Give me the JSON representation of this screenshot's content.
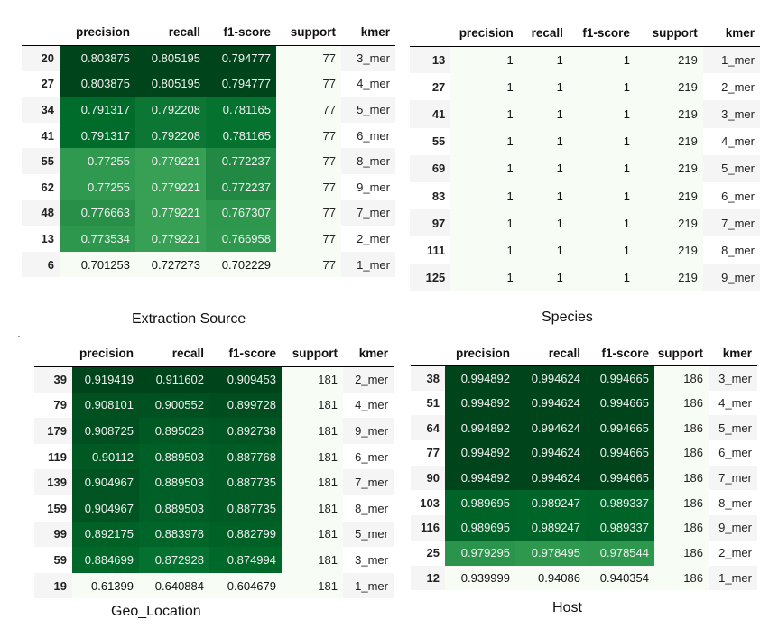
{
  "columns": [
    "",
    "precision",
    "recall",
    "f1-score",
    "support",
    "kmer"
  ],
  "tables": [
    {
      "caption": "Extraction Source",
      "rows": [
        {
          "idx": "20",
          "precision": "0.803875",
          "recall": "0.805195",
          "f1": "0.794777",
          "support": "77",
          "kmer": "3_mer",
          "p": 0.803875,
          "r": 0.805195,
          "f": 0.794777
        },
        {
          "idx": "27",
          "precision": "0.803875",
          "recall": "0.805195",
          "f1": "0.794777",
          "support": "77",
          "kmer": "4_mer",
          "p": 0.803875,
          "r": 0.805195,
          "f": 0.794777
        },
        {
          "idx": "34",
          "precision": "0.791317",
          "recall": "0.792208",
          "f1": "0.781165",
          "support": "77",
          "kmer": "5_mer",
          "p": 0.791317,
          "r": 0.792208,
          "f": 0.781165
        },
        {
          "idx": "41",
          "precision": "0.791317",
          "recall": "0.792208",
          "f1": "0.781165",
          "support": "77",
          "kmer": "6_mer",
          "p": 0.791317,
          "r": 0.792208,
          "f": 0.781165
        },
        {
          "idx": "55",
          "precision": "0.77255",
          "recall": "0.779221",
          "f1": "0.772237",
          "support": "77",
          "kmer": "8_mer",
          "p": 0.77255,
          "r": 0.779221,
          "f": 0.772237
        },
        {
          "idx": "62",
          "precision": "0.77255",
          "recall": "0.779221",
          "f1": "0.772237",
          "support": "77",
          "kmer": "9_mer",
          "p": 0.77255,
          "r": 0.779221,
          "f": 0.772237
        },
        {
          "idx": "48",
          "precision": "0.776663",
          "recall": "0.779221",
          "f1": "0.767307",
          "support": "77",
          "kmer": "7_mer",
          "p": 0.776663,
          "r": 0.779221,
          "f": 0.767307
        },
        {
          "idx": "13",
          "precision": "0.773534",
          "recall": "0.779221",
          "f1": "0.766958",
          "support": "77",
          "kmer": "2_mer",
          "p": 0.773534,
          "r": 0.779221,
          "f": 0.766958
        },
        {
          "idx": "6",
          "precision": "0.701253",
          "recall": "0.727273",
          "f1": "0.702229",
          "support": "77",
          "kmer": "1_mer",
          "p": 0.701253,
          "r": 0.727273,
          "f": 0.702229
        }
      ]
    },
    {
      "caption": "Species",
      "rows": [
        {
          "idx": "13",
          "precision": "1",
          "recall": "1",
          "f1": "1",
          "support": "219",
          "kmer": "1_mer",
          "p": 1,
          "r": 1,
          "f": 1
        },
        {
          "idx": "27",
          "precision": "1",
          "recall": "1",
          "f1": "1",
          "support": "219",
          "kmer": "2_mer",
          "p": 1,
          "r": 1,
          "f": 1
        },
        {
          "idx": "41",
          "precision": "1",
          "recall": "1",
          "f1": "1",
          "support": "219",
          "kmer": "3_mer",
          "p": 1,
          "r": 1,
          "f": 1
        },
        {
          "idx": "55",
          "precision": "1",
          "recall": "1",
          "f1": "1",
          "support": "219",
          "kmer": "4_mer",
          "p": 1,
          "r": 1,
          "f": 1
        },
        {
          "idx": "69",
          "precision": "1",
          "recall": "1",
          "f1": "1",
          "support": "219",
          "kmer": "5_mer",
          "p": 1,
          "r": 1,
          "f": 1
        },
        {
          "idx": "83",
          "precision": "1",
          "recall": "1",
          "f1": "1",
          "support": "219",
          "kmer": "6_mer",
          "p": 1,
          "r": 1,
          "f": 1
        },
        {
          "idx": "97",
          "precision": "1",
          "recall": "1",
          "f1": "1",
          "support": "219",
          "kmer": "7_mer",
          "p": 1,
          "r": 1,
          "f": 1
        },
        {
          "idx": "111",
          "precision": "1",
          "recall": "1",
          "f1": "1",
          "support": "219",
          "kmer": "8_mer",
          "p": 1,
          "r": 1,
          "f": 1
        },
        {
          "idx": "125",
          "precision": "1",
          "recall": "1",
          "f1": "1",
          "support": "219",
          "kmer": "9_mer",
          "p": 1,
          "r": 1,
          "f": 1
        }
      ]
    },
    {
      "caption": "Geo_Location",
      "rows": [
        {
          "idx": "39",
          "precision": "0.919419",
          "recall": "0.911602",
          "f1": "0.909453",
          "support": "181",
          "kmer": "2_mer",
          "p": 0.919419,
          "r": 0.911602,
          "f": 0.909453
        },
        {
          "idx": "79",
          "precision": "0.908101",
          "recall": "0.900552",
          "f1": "0.899728",
          "support": "181",
          "kmer": "4_mer",
          "p": 0.908101,
          "r": 0.900552,
          "f": 0.899728
        },
        {
          "idx": "179",
          "precision": "0.908725",
          "recall": "0.895028",
          "f1": "0.892738",
          "support": "181",
          "kmer": "9_mer",
          "p": 0.908725,
          "r": 0.895028,
          "f": 0.892738
        },
        {
          "idx": "119",
          "precision": "0.90112",
          "recall": "0.889503",
          "f1": "0.887768",
          "support": "181",
          "kmer": "6_mer",
          "p": 0.90112,
          "r": 0.889503,
          "f": 0.887768
        },
        {
          "idx": "139",
          "precision": "0.904967",
          "recall": "0.889503",
          "f1": "0.887735",
          "support": "181",
          "kmer": "7_mer",
          "p": 0.904967,
          "r": 0.889503,
          "f": 0.887735
        },
        {
          "idx": "159",
          "precision": "0.904967",
          "recall": "0.889503",
          "f1": "0.887735",
          "support": "181",
          "kmer": "8_mer",
          "p": 0.904967,
          "r": 0.889503,
          "f": 0.887735
        },
        {
          "idx": "99",
          "precision": "0.892175",
          "recall": "0.883978",
          "f1": "0.882799",
          "support": "181",
          "kmer": "5_mer",
          "p": 0.892175,
          "r": 0.883978,
          "f": 0.882799
        },
        {
          "idx": "59",
          "precision": "0.884699",
          "recall": "0.872928",
          "f1": "0.874994",
          "support": "181",
          "kmer": "3_mer",
          "p": 0.884699,
          "r": 0.872928,
          "f": 0.874994
        },
        {
          "idx": "19",
          "precision": "0.61399",
          "recall": "0.640884",
          "f1": "0.604679",
          "support": "181",
          "kmer": "1_mer",
          "p": 0.61399,
          "r": 0.640884,
          "f": 0.604679
        }
      ]
    },
    {
      "caption": "Host",
      "rows": [
        {
          "idx": "38",
          "precision": "0.994892",
          "recall": "0.994624",
          "f1": "0.994665",
          "support": "186",
          "kmer": "3_mer",
          "p": 0.994892,
          "r": 0.994624,
          "f": 0.994665
        },
        {
          "idx": "51",
          "precision": "0.994892",
          "recall": "0.994624",
          "f1": "0.994665",
          "support": "186",
          "kmer": "4_mer",
          "p": 0.994892,
          "r": 0.994624,
          "f": 0.994665
        },
        {
          "idx": "64",
          "precision": "0.994892",
          "recall": "0.994624",
          "f1": "0.994665",
          "support": "186",
          "kmer": "5_mer",
          "p": 0.994892,
          "r": 0.994624,
          "f": 0.994665
        },
        {
          "idx": "77",
          "precision": "0.994892",
          "recall": "0.994624",
          "f1": "0.994665",
          "support": "186",
          "kmer": "6_mer",
          "p": 0.994892,
          "r": 0.994624,
          "f": 0.994665
        },
        {
          "idx": "90",
          "precision": "0.994892",
          "recall": "0.994624",
          "f1": "0.994665",
          "support": "186",
          "kmer": "7_mer",
          "p": 0.994892,
          "r": 0.994624,
          "f": 0.994665
        },
        {
          "idx": "103",
          "precision": "0.989695",
          "recall": "0.989247",
          "f1": "0.989337",
          "support": "186",
          "kmer": "8_mer",
          "p": 0.989695,
          "r": 0.989247,
          "f": 0.989337
        },
        {
          "idx": "116",
          "precision": "0.989695",
          "recall": "0.989247",
          "f1": "0.989337",
          "support": "186",
          "kmer": "9_mer",
          "p": 0.989695,
          "r": 0.989247,
          "f": 0.989337
        },
        {
          "idx": "25",
          "precision": "0.979295",
          "recall": "0.978495",
          "f1": "0.978544",
          "support": "186",
          "kmer": "2_mer",
          "p": 0.979295,
          "r": 0.978495,
          "f": 0.978544
        },
        {
          "idx": "12",
          "precision": "0.939999",
          "recall": "0.94086",
          "f1": "0.940354",
          "support": "186",
          "kmer": "1_mer",
          "p": 0.939999,
          "r": 0.94086,
          "f": 0.940354
        }
      ]
    }
  ],
  "colors": {
    "light": "#f7fcf5",
    "dark": "#00441b"
  }
}
